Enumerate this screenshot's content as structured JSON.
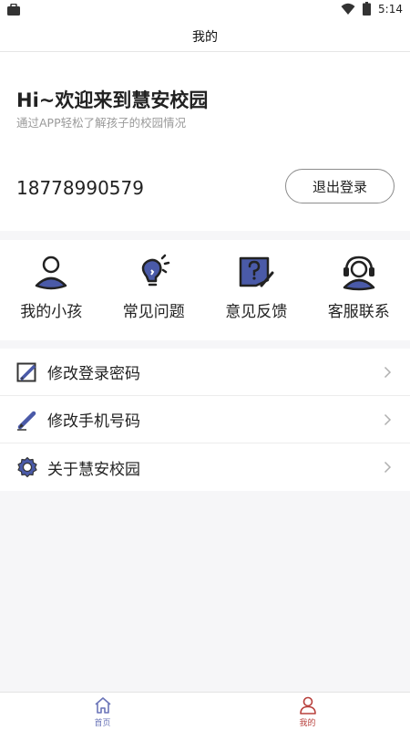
{
  "status_bar": {
    "time": "5:14"
  },
  "nav": {
    "title": "我的"
  },
  "profile": {
    "greeting": "Hi~欢迎来到慧安校园",
    "subtitle": "通过APP轻松了解孩子的校园情况",
    "phone": "18778990579",
    "logout_label": "退出登录"
  },
  "quick_actions": [
    {
      "label": "我的小孩",
      "icon": "child-person-icon"
    },
    {
      "label": "常见问题",
      "icon": "lightbulb-icon"
    },
    {
      "label": "意见反馈",
      "icon": "feedback-question-icon"
    },
    {
      "label": "客服联系",
      "icon": "headset-icon"
    }
  ],
  "menu": [
    {
      "label": "修改登录密码",
      "icon": "edit-square-icon"
    },
    {
      "label": "修改手机号码",
      "icon": "pencil-icon"
    },
    {
      "label": "关于慧安校园",
      "icon": "gear-icon"
    }
  ],
  "tabs": [
    {
      "label": "首页",
      "icon": "home-icon",
      "active": false
    },
    {
      "label": "我的",
      "icon": "user-icon",
      "active": true
    }
  ],
  "colors": {
    "accent_blue": "#4a5aa8",
    "active_tab": "#b8413d",
    "inactive_tab": "#6a74b8"
  }
}
